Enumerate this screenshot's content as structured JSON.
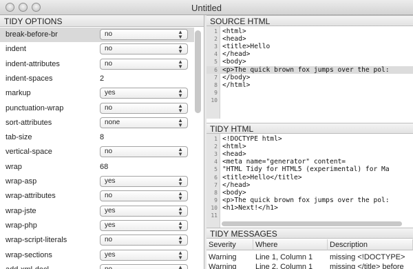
{
  "window": {
    "title": "Untitled"
  },
  "tidy_options": {
    "header": "TIDY OPTIONS",
    "rows": [
      {
        "label": "break-before-br",
        "kind": "select",
        "value": "no",
        "selected": true
      },
      {
        "label": "indent",
        "kind": "select",
        "value": "no"
      },
      {
        "label": "indent-attributes",
        "kind": "select",
        "value": "no"
      },
      {
        "label": "indent-spaces",
        "kind": "text",
        "value": "2"
      },
      {
        "label": "markup",
        "kind": "select",
        "value": "yes"
      },
      {
        "label": "punctuation-wrap",
        "kind": "select",
        "value": "no"
      },
      {
        "label": "sort-attributes",
        "kind": "select",
        "value": "none"
      },
      {
        "label": "tab-size",
        "kind": "text",
        "value": "8"
      },
      {
        "label": "vertical-space",
        "kind": "select",
        "value": "no"
      },
      {
        "label": "wrap",
        "kind": "text",
        "value": "68"
      },
      {
        "label": "wrap-asp",
        "kind": "select",
        "value": "yes"
      },
      {
        "label": "wrap-attributes",
        "kind": "select",
        "value": "no"
      },
      {
        "label": "wrap-jste",
        "kind": "select",
        "value": "yes"
      },
      {
        "label": "wrap-php",
        "kind": "select",
        "value": "yes"
      },
      {
        "label": "wrap-script-literals",
        "kind": "select",
        "value": "no"
      },
      {
        "label": "wrap-sections",
        "kind": "select",
        "value": "yes"
      },
      {
        "label": "add-xml-decl",
        "kind": "select",
        "value": "no"
      }
    ]
  },
  "source_html": {
    "header": "SOURCE HTML",
    "highlight_line": 6,
    "lines": [
      "<html>",
      "<head>",
      "<title>Hello",
      "</head>",
      "<body>",
      "<p>The quick brown fox jumps over the pol:",
      "</body>",
      "</html>",
      "",
      ""
    ]
  },
  "tidy_html": {
    "header": "TIDY HTML",
    "lines": [
      "<!DOCTYPE html>",
      "<html>",
      "<head>",
      "<meta name=\"generator\" content=",
      "\"HTML Tidy for HTML5 (experimental) for Ma",
      "<title>Hello</title>",
      "</head>",
      "<body>",
      "<p>The quick brown fox jumps over the pol:",
      "<h1>Next!</h1>",
      ""
    ]
  },
  "tidy_messages": {
    "header": "TIDY MESSAGES",
    "columns": [
      "Severity",
      "Where",
      "Description"
    ],
    "rows": [
      [
        "Warning",
        "Line 1, Column 1",
        "missing <!DOCTYPE>"
      ],
      [
        "Warning",
        "Line 2, Column 1",
        "missing </title> before"
      ]
    ]
  }
}
